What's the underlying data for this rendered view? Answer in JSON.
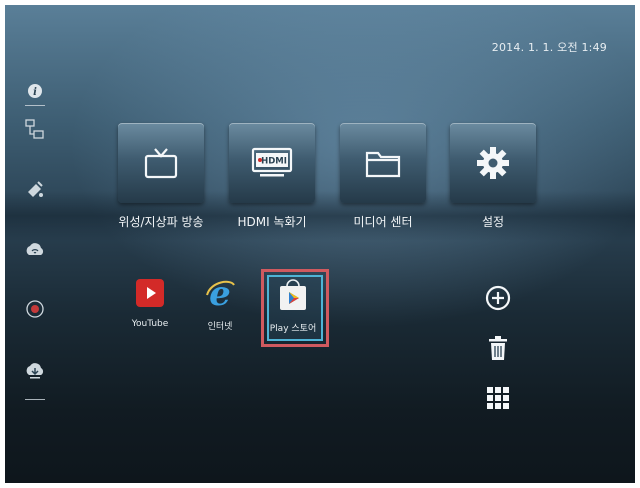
{
  "status_bar": {
    "clock": "2014. 1. 1. 오전 1:49"
  },
  "sidebar": {
    "items": [
      {
        "icon": "info-icon"
      },
      {
        "icon": "network-icon"
      },
      {
        "icon": "satellite-icon"
      },
      {
        "icon": "wifi-cloud-icon"
      },
      {
        "icon": "record-icon"
      },
      {
        "icon": "cloud-download-icon"
      }
    ]
  },
  "main_menu": [
    {
      "label": "위성/지상파 방송",
      "icon": "tv-icon"
    },
    {
      "label": "HDMI 녹화기",
      "icon": "hdmi-recorder-icon",
      "badge": "HDMI"
    },
    {
      "label": "미디어 센터",
      "icon": "folder-icon"
    },
    {
      "label": "설정",
      "icon": "gear-icon"
    }
  ],
  "apps": [
    {
      "label": "YouTube",
      "icon": "youtube-icon"
    },
    {
      "label": "인터넷",
      "icon": "internet-explorer-icon"
    },
    {
      "label": "Play 스토어",
      "icon": "play-store-icon",
      "selected": true
    }
  ],
  "controls": [
    {
      "icon": "add-circle-icon"
    },
    {
      "icon": "trash-icon"
    },
    {
      "icon": "grid-apps-icon"
    }
  ],
  "colors": {
    "selection_border": "#d05a5f",
    "focus_border": "#4fb4d6",
    "youtube_red": "#d32a28"
  }
}
